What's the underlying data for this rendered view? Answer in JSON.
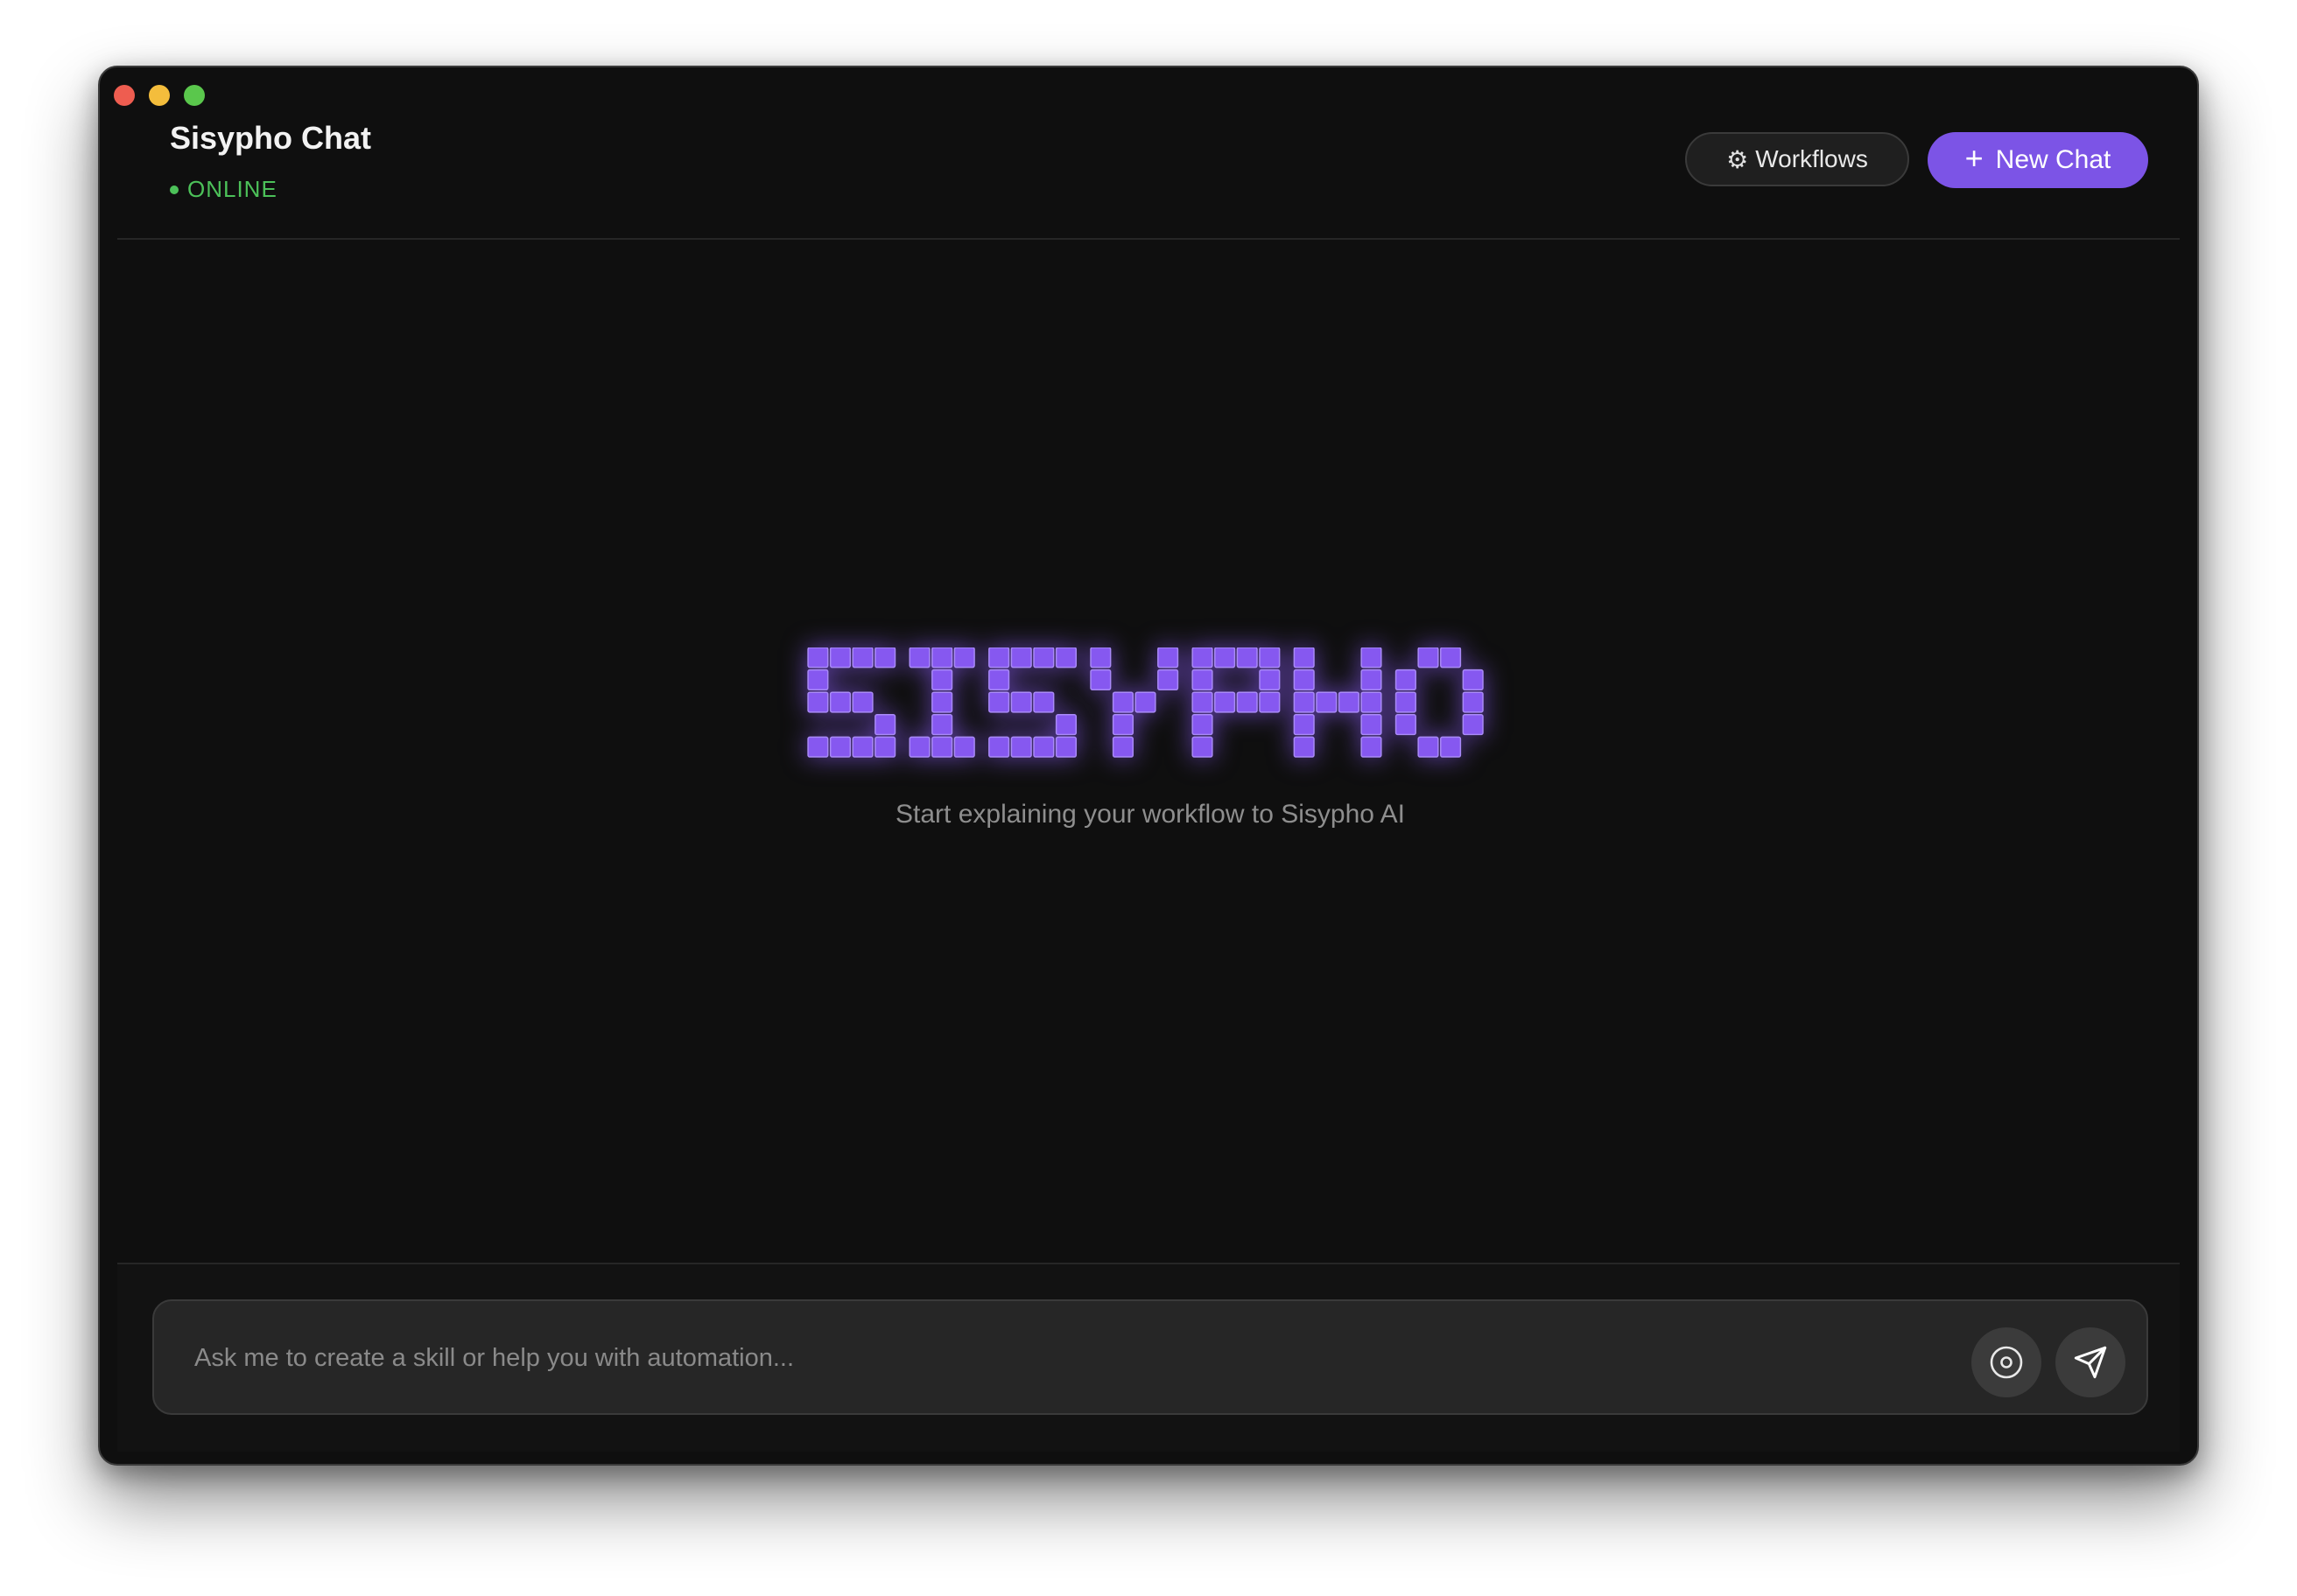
{
  "window": {
    "title": "Sisypho Chat",
    "status": "ONLINE",
    "status_color": "#4cc159"
  },
  "toolbar": {
    "workflows_label": "Workflows",
    "workflows_icon": "gear-icon",
    "new_chat_label": "New Chat",
    "new_chat_icon": "plus-icon",
    "accent_color": "#7c54e6"
  },
  "hero": {
    "logo_text": "SISYPHO",
    "logo_color": "#8658f0",
    "tagline": "Start explaining your workflow to Sisypho AI"
  },
  "composer": {
    "placeholder": "Ask me to create a skill or help you with automation...",
    "value": "",
    "record_icon": "record-icon",
    "send_icon": "send-icon"
  }
}
